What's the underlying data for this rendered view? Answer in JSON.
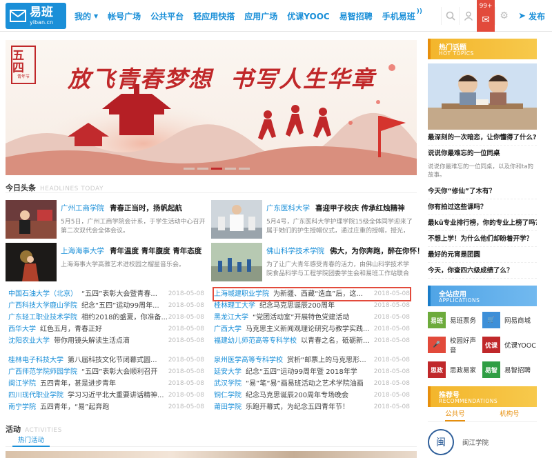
{
  "header": {
    "logo_text": "易班",
    "logo_sub": "yiban.cn",
    "nav": [
      {
        "label": "我的",
        "caret": true
      },
      {
        "label": "帐号广场"
      },
      {
        "label": "公共平台"
      },
      {
        "label": "轻应用快搭"
      },
      {
        "label": "应用广场"
      },
      {
        "label": "优课YOOC"
      },
      {
        "label": "易智招聘"
      },
      {
        "label": "手机易班"
      }
    ],
    "mail_badge": "99+",
    "publish_label": "发布"
  },
  "banner": {
    "seal_text": "五四",
    "seal_small": "青年节",
    "slogan_left": "放飞青春梦想",
    "slogan_right": "书写人生华章"
  },
  "headlines": {
    "title": "今日头条",
    "title_en": "HEADLINES TODAY",
    "features": [
      {
        "source": "广州工商学院",
        "title": "青春正当时，扬帆起航",
        "desc": "5月5日，广州工商学院会计系，于学生活动中心召开第二次双代会全体会议。"
      },
      {
        "source": "广东医科大学",
        "title": "喜迎甲子校庆 传承红烛精神",
        "desc": "5月4号，广东医科大学护理学院15级全体同学迎来了属于她们的护生授帽仪式，通过庄重的授帽，授光，宣誓成为准护"
      },
      {
        "source": "上海海事大学",
        "title": "青年温度 青年腹度 青年态度",
        "desc": "上海海事大学高雅艺术进校园之榴星音乐会。"
      },
      {
        "source": "佛山科学技术学院",
        "title": "佛大，为你奔跑，醉在你怀！",
        "desc": "为了让广大青年感受青春的活力，由佛山科学技术学院食品科学与工程学院团委学生会和易班工作站联合举办的“我爱"
      }
    ],
    "list_left": [
      {
        "source": "中国石油大学（北京）",
        "text": "“五四”表彰大会暨青春...",
        "date": "2018-05-08"
      },
      {
        "source": "广西科技大学鹿山学院",
        "text": "纪念“五四”运动99周年...",
        "date": "2018-05-08"
      },
      {
        "source": "广东轻工职业技术学院",
        "text": "相约2018的盛夏，你准备...",
        "date": "2018-05-08"
      },
      {
        "source": "西华大学",
        "text": "红色五月，青春正好",
        "date": "2018-05-08"
      },
      {
        "source": "沈阳农业大学",
        "text": "带你用镜头解读生活点滴",
        "date": "2018-05-08"
      }
    ],
    "list_right": [
      {
        "source": "上海城建职业学院",
        "text": "为新疆、西藏“造血”后，这...",
        "date": "2018-05-08",
        "highlight": true
      },
      {
        "source": "桂林理工大学",
        "text": "纪念马克思诞辰200周年",
        "date": "2018-05-08"
      },
      {
        "source": "黑龙江大学",
        "text": "“党团活动室”开展特色党建活动",
        "date": "2018-05-08"
      },
      {
        "source": "广西大学",
        "text": "马克思主义新闻观理论研究与教学实践...",
        "date": "2018-05-08"
      },
      {
        "source": "福建幼儿师范高等专科学校",
        "text": "以青春之名，砥砺新...",
        "date": "2018-05-08"
      }
    ],
    "list_left2": [
      {
        "source": "桂林电子科技大学",
        "text": "第八届科技文化节闭幕式圆...",
        "date": "2018-05-08"
      },
      {
        "source": "广西师范学院师园学院",
        "text": "“五四”表彰大会顺利召开",
        "date": "2018-05-08"
      },
      {
        "source": "闽江学院",
        "text": "五四青年，甚是进步青年",
        "date": "2018-05-08"
      },
      {
        "source": "四川现代职业学院",
        "text": "学习习近平北大重要讲话精神...",
        "date": "2018-05-08"
      },
      {
        "source": "南宁学院",
        "text": "五四青年，“易”起奔跑",
        "date": "2018-05-08"
      }
    ],
    "list_right2": [
      {
        "source": "泉州医学高等专科学校",
        "text": "赏析“邮票上的马克思形...",
        "date": "2018-05-08"
      },
      {
        "source": "延安大学",
        "text": "纪念“五四”运动99周年暨 2018年学",
        "date": "2018-05-08"
      },
      {
        "source": "武汉学院",
        "text": "“易”笔“易”画易班活动之艺术学院油画",
        "date": "2018-05-08"
      },
      {
        "source": "铜仁学院",
        "text": "纪念马克思诞辰200周年专场晚会",
        "date": "2018-05-08"
      },
      {
        "source": "莆田学院",
        "text": "乐跑开幕式，为纪念五四青年节！",
        "date": "2018-05-08"
      }
    ]
  },
  "activities": {
    "title": "活动",
    "title_en": "ACTIVITIES",
    "tab": "热门活动"
  },
  "sidebar": {
    "hot": {
      "title": "热门话题",
      "title_en": "HOT TOPICS"
    },
    "topics": [
      {
        "q": "最深刻的一次暗恋，让你懂得了什么?"
      },
      {
        "q": "说说你最难忘的一位同桌",
        "desc": "说说你最难忘的一位同桌，以及你和ta的故事。"
      },
      {
        "q": "今天你“修仙”了木有？"
      },
      {
        "q": "你有拍过这些课吗？"
      },
      {
        "q": "最kū专业排行榜，你的专业上榜了吗？"
      },
      {
        "q": "不想上学！为什么他们却盼着开学？"
      },
      {
        "q": "最好的元宵是团圆"
      },
      {
        "q": "今天，你查四六级成绩了么？"
      }
    ],
    "apps_head": {
      "title": "全站应用",
      "title_en": "APPLICATIONS"
    },
    "apps": [
      {
        "label": "易班票务",
        "icon": "ticket-icon",
        "badge": "易班",
        "color": "#6dab3c"
      },
      {
        "label": "网易商城",
        "icon": "cart-icon",
        "badge": "🛒",
        "color": "#3d8fd8"
      },
      {
        "label": "校园好声音",
        "icon": "mic-icon",
        "badge": "🎤",
        "color": "#e24a3b"
      },
      {
        "label": "优课YOOC",
        "icon": "yooc-icon",
        "badge": "优课",
        "color": "#c0282a"
      },
      {
        "label": "思政易家",
        "icon": "politics-icon",
        "badge": "思政",
        "color": "#c0282a"
      },
      {
        "label": "易智招聘",
        "icon": "recruit-icon",
        "badge": "易智",
        "color": "#2f9e44"
      }
    ],
    "rec_head": {
      "title": "推荐号",
      "title_en": "RECOMMENDATIONS"
    },
    "rec_tabs": [
      "公共号",
      "机构号"
    ],
    "rec_item": {
      "name": "闽江学院",
      "emblem": "闽"
    }
  }
}
